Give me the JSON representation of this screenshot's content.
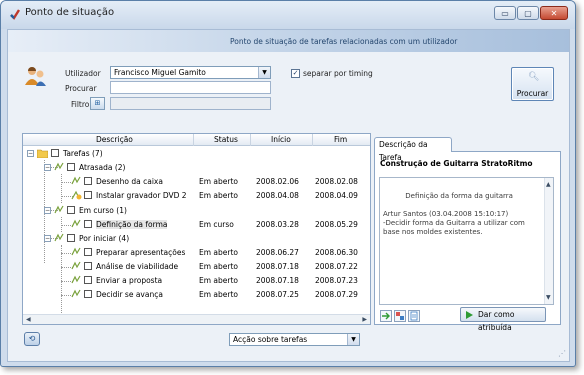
{
  "window": {
    "title": "Ponto de situação",
    "controls": {
      "minimize": "▭",
      "maximize": "▢",
      "close": "✕"
    }
  },
  "header": {
    "text": "Ponto de situação de tarefas relacionadas com um utilizador"
  },
  "form": {
    "utilizador_label": "Utilizador",
    "utilizador_value": "Francisco Miguel Gamito",
    "procurar_label": "Procurar",
    "procurar_value": "",
    "filtro_label": "Filtro",
    "separar_label": "separar por timing",
    "separar_checked": true,
    "procurar_button": "Procurar"
  },
  "tree": {
    "columns": {
      "descricao": "Descrição",
      "status": "Status",
      "inicio": "Início",
      "fim": "Fim"
    },
    "rows": [
      {
        "label": "Tarefas (7)",
        "status": "",
        "inicio": "",
        "fim": ""
      },
      {
        "label": "Atrasada (2)",
        "status": "",
        "inicio": "",
        "fim": ""
      },
      {
        "label": "Desenho da caixa",
        "status": "Em aberto",
        "inicio": "2008.02.06",
        "fim": "2008.02.08"
      },
      {
        "label": "Instalar gravador DVD 2",
        "status": "Em aberto",
        "inicio": "2008.04.08",
        "fim": "2008.04.09"
      },
      {
        "label": "Em curso (1)",
        "status": "",
        "inicio": "",
        "fim": ""
      },
      {
        "label": "Definição da forma",
        "status": "Em curso",
        "inicio": "2008.03.28",
        "fim": "2008.05.29"
      },
      {
        "label": "Por iniciar (4)",
        "status": "",
        "inicio": "",
        "fim": ""
      },
      {
        "label": "Preparar apresentações",
        "status": "Em aberto",
        "inicio": "2008.06.27",
        "fim": "2008.06.30"
      },
      {
        "label": "Análise de viabilidade",
        "status": "Em aberto",
        "inicio": "2008.07.18",
        "fim": "2008.07.22"
      },
      {
        "label": "Enviar a proposta",
        "status": "Em aberto",
        "inicio": "2008.07.18",
        "fim": "2008.07.23"
      },
      {
        "label": "Decidir se avança",
        "status": "Em aberto",
        "inicio": "2008.07.25",
        "fim": "2008.07.29"
      }
    ]
  },
  "description": {
    "tab": "Descrição da Tarefa",
    "title": "Construção de Guitarra StratoRitmo",
    "text": "Definição da forma da guitarra\n\nArtur Santos (03.04.2008 15:10:17)\n-Decidir forma da Guitarra a utilizar com base nos moldes existentes.",
    "assign_button": "Dar como atribuída"
  },
  "footer": {
    "action_combo": "Acção sobre tarefas"
  },
  "colors": {
    "accent": "#24466e",
    "window_bg": "#cfdcec",
    "selected_row": "#e6e6e6"
  },
  "icons": {
    "title": "app-icon",
    "users": "users-icon",
    "filter": "filter-icon",
    "search": "magnifier-icon",
    "folder": "folder-icon",
    "task": "task-icon",
    "assign": "play-icon",
    "bottom": "refresh-icon"
  }
}
